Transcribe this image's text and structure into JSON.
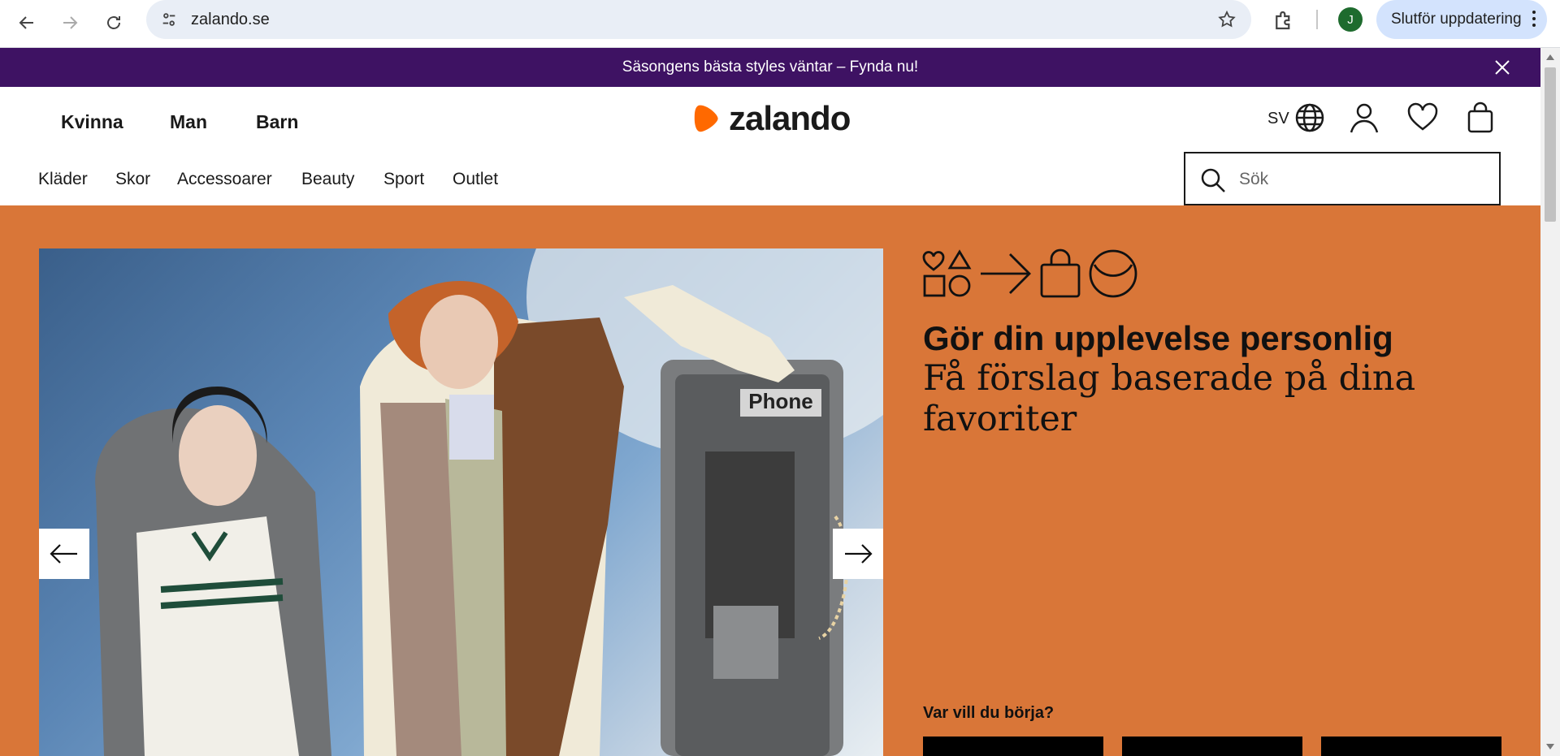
{
  "browser": {
    "url": "zalando.se",
    "profile_initial": "J",
    "update_label": "Slutför uppdatering"
  },
  "promo": {
    "text": "Säsongens bästa styles väntar – Fynda nu!"
  },
  "header": {
    "logo_text": "zalando",
    "gender_nav": [
      "Kvinna",
      "Man",
      "Barn"
    ],
    "language": "SV",
    "categories": [
      "Kläder",
      "Skor",
      "Accessoarer",
      "Beauty",
      "Sport",
      "Outlet"
    ],
    "search_placeholder": "Sök"
  },
  "hero": {
    "title": "Gör din upplevelse personlig",
    "subtitle": "Få förslag baserade på dina favoriter",
    "where_label": "Var vill du börja?",
    "photo_text": "Phone"
  },
  "colors": {
    "promo_bg": "#3e1263",
    "hero_bg": "#d97638",
    "brand_orange": "#ff6900",
    "avatar": "#1e6b2e",
    "update_btn": "#d3e3fd"
  }
}
